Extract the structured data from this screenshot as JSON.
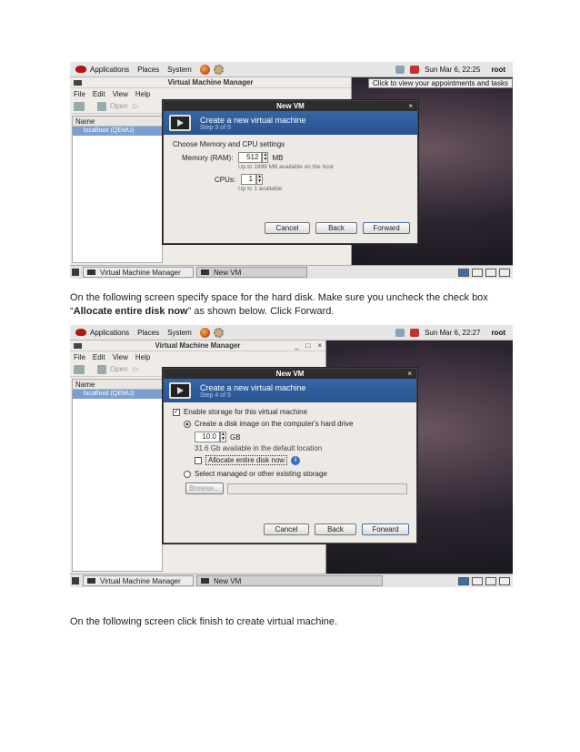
{
  "screenshot1": {
    "panel": {
      "menus": [
        "Applications",
        "Places",
        "System"
      ],
      "clock": "Sun Mar  6, 22:25",
      "user": "root"
    },
    "vmm": {
      "title": "Virtual Machine Manager",
      "menus": [
        "File",
        "Edit",
        "View",
        "Help"
      ],
      "toolbar_open": "Open",
      "list_header": "Name",
      "list_row": "localhost (QEMU)"
    },
    "calendar_hint": "Click to view your appointments and tasks",
    "dialog": {
      "title": "New VM",
      "banner_title": "Create a new virtual machine",
      "banner_step": "Step 3 of 5",
      "section": "Choose Memory and CPU settings",
      "memory_label": "Memory (RAM):",
      "memory_value": "512",
      "memory_unit": "MB",
      "memory_hint": "Up to 1999 MB available on the host",
      "cpus_label": "CPUs:",
      "cpus_value": "1",
      "cpus_hint": "Up to 1 available",
      "cancel": "Cancel",
      "back": "Back",
      "forward": "Forward"
    },
    "taskbar": {
      "task1": "Virtual Machine Manager",
      "task2": "New VM"
    }
  },
  "paragraph1": {
    "text_before": "On the following screen specify space for the hard disk. Make sure you uncheck the check box “",
    "bold": "Allocate entire disk now",
    "text_after": "” as shown below. Click Forward."
  },
  "screenshot2": {
    "panel": {
      "menus": [
        "Applications",
        "Places",
        "System"
      ],
      "clock": "Sun Mar  6, 22:27",
      "user": "root"
    },
    "vmm": {
      "title": "Virtual Machine Manager",
      "menus": [
        "File",
        "Edit",
        "View",
        "Help"
      ],
      "toolbar_open": "Open",
      "list_header": "Name",
      "list_row": "localhost (QEMU)",
      "win_controls": [
        "_",
        "□",
        "×"
      ]
    },
    "dialog": {
      "title": "New VM",
      "banner_title": "Create a new virtual machine",
      "banner_step": "Step 4 of 5",
      "enable_storage": "Enable storage for this virtual machine",
      "create_disk": "Create a disk image on the computer's hard drive",
      "size_value": "10.0",
      "size_unit": "GB",
      "available": "31.6 Gb available in the default location",
      "allocate": "Allocate entire disk now",
      "select_managed": "Select managed or other existing storage",
      "browse": "Browse...",
      "cancel": "Cancel",
      "back": "Back",
      "forward": "Forward"
    },
    "taskbar": {
      "task1": "Virtual Machine Manager",
      "task2": "New VM"
    }
  },
  "paragraph2": {
    "text": "On the following screen click finish to create virtual machine."
  }
}
